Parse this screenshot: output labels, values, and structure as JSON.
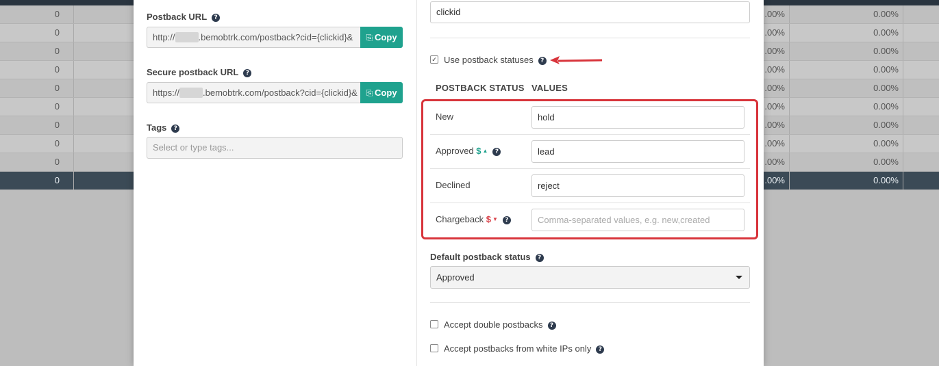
{
  "background_table": {
    "rows": [
      {
        "count": "0",
        "pct1": ".00%",
        "pct2": "0.00%"
      },
      {
        "count": "0",
        "pct1": ".00%",
        "pct2": "0.00%"
      },
      {
        "count": "0",
        "pct1": ".00%",
        "pct2": "0.00%"
      },
      {
        "count": "0",
        "pct1": ".00%",
        "pct2": "0.00%"
      },
      {
        "count": "0",
        "pct1": ".00%",
        "pct2": "0.00%"
      },
      {
        "count": "0",
        "pct1": ".00%",
        "pct2": "0.00%"
      },
      {
        "count": "0",
        "pct1": ".00%",
        "pct2": "0.00%"
      },
      {
        "count": "0",
        "pct1": ".00%",
        "pct2": "0.00%"
      },
      {
        "count": "0",
        "pct1": ".00%",
        "pct2": "0.00%"
      }
    ],
    "total": {
      "count": "0",
      "pct1": ".00%",
      "pct2": "0.00%"
    }
  },
  "left": {
    "postback_url_label": "Postback URL",
    "postback_url_prefix": "http://",
    "postback_url_suffix": ".bemobtrk.com/postback?cid={clickid}&",
    "secure_postback_url_label": "Secure postback URL",
    "secure_postback_url_prefix": "https://",
    "secure_postback_url_suffix": ".bemobtrk.com/postback?cid={clickid}&",
    "copy_label": "Copy",
    "tags_label": "Tags",
    "tags_placeholder": "Select or type tags..."
  },
  "right": {
    "clickid_value": "clickid",
    "use_postback_statuses_label": "Use postback statuses",
    "use_postback_statuses_checked": true,
    "col_status": "POSTBACK STATUS",
    "col_values": "VALUES",
    "statuses": [
      {
        "name": "New",
        "value": "hold",
        "placeholder": ""
      },
      {
        "name": "Approved",
        "value": "lead",
        "placeholder": ""
      },
      {
        "name": "Declined",
        "value": "reject",
        "placeholder": ""
      },
      {
        "name": "Chargeback",
        "value": "",
        "placeholder": "Comma-separated values, e.g. new,created"
      }
    ],
    "default_status_label": "Default postback status",
    "default_status_value": "Approved",
    "accept_double_label": "Accept double postbacks",
    "accept_white_ips_label": "Accept postbacks from white IPs only"
  },
  "colors": {
    "accent": "#1fa28e",
    "highlight": "#d8343b",
    "negative": "#d9424a"
  }
}
